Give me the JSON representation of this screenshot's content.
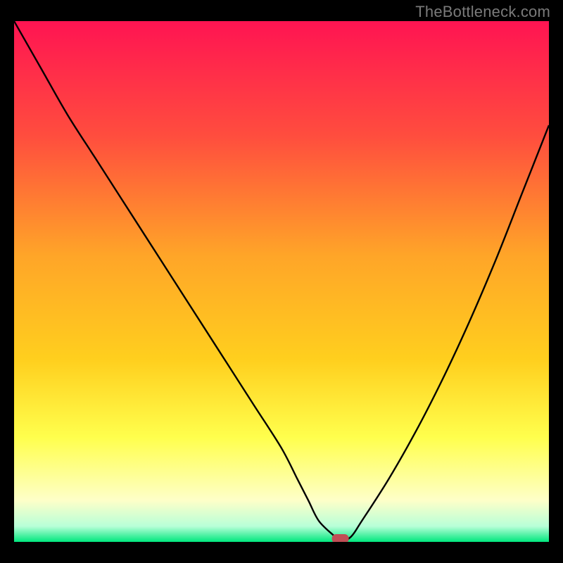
{
  "watermark": {
    "text": "TheBottleneck.com"
  },
  "colors": {
    "background": "#000000",
    "grad_top": "#ff1452",
    "grad_mid1": "#ff6e36",
    "grad_mid2": "#ffcf1e",
    "grad_mid3": "#ffff4d",
    "grad_pale": "#feffc8",
    "grad_green": "#00e77e",
    "curve": "#000000",
    "marker": "#c14e55"
  },
  "chart_data": {
    "type": "line",
    "title": "",
    "xlabel": "",
    "ylabel": "",
    "x": [
      0,
      5,
      10,
      15,
      20,
      25,
      30,
      35,
      40,
      45,
      50,
      53,
      55,
      57,
      60,
      61,
      63,
      65,
      70,
      75,
      80,
      85,
      90,
      95,
      100
    ],
    "values": [
      100,
      91,
      82,
      74,
      66,
      58,
      50,
      42,
      34,
      26,
      18,
      12,
      8,
      4,
      1,
      0,
      1,
      4,
      12,
      21,
      31,
      42,
      54,
      67,
      80
    ],
    "xlim": [
      0,
      100
    ],
    "ylim": [
      0,
      100
    ],
    "minimum": {
      "x": 61,
      "y": 0
    },
    "note": "x and y are in percent of plot width/height; y=0 is bottom. Values estimated from plotted curve; left branch is roughly linear with a slight outward bow near the top, right branch curves upward with increasing slope."
  }
}
